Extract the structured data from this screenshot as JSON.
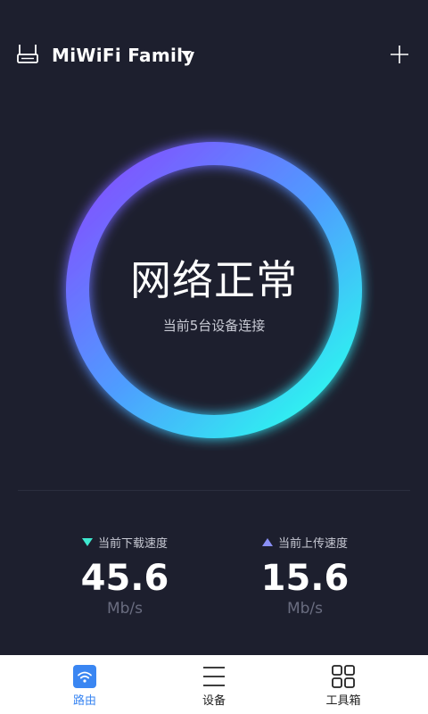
{
  "header": {
    "network_name": "MiWiFi Family"
  },
  "status": {
    "title": "网络正常",
    "subtitle": "当前5台设备连接"
  },
  "speeds": {
    "download": {
      "label": "当前下载速度",
      "value": "45.6",
      "unit": "Mb/s"
    },
    "upload": {
      "label": "当前上传速度",
      "value": "15.6",
      "unit": "Mb/s"
    }
  },
  "tabs": [
    {
      "label": "路由",
      "icon": "wifi-icon",
      "active": true
    },
    {
      "label": "设备",
      "icon": "list-icon",
      "active": false
    },
    {
      "label": "工具箱",
      "icon": "grid-icon",
      "active": false
    }
  ],
  "colors": {
    "background": "#1d1f2e",
    "ring_start": "#7a5cff",
    "ring_end": "#2ef2f0",
    "download_accent": "#3ee8cf",
    "upload_accent": "#8a8ff5",
    "tab_active": "#3a86f2"
  }
}
